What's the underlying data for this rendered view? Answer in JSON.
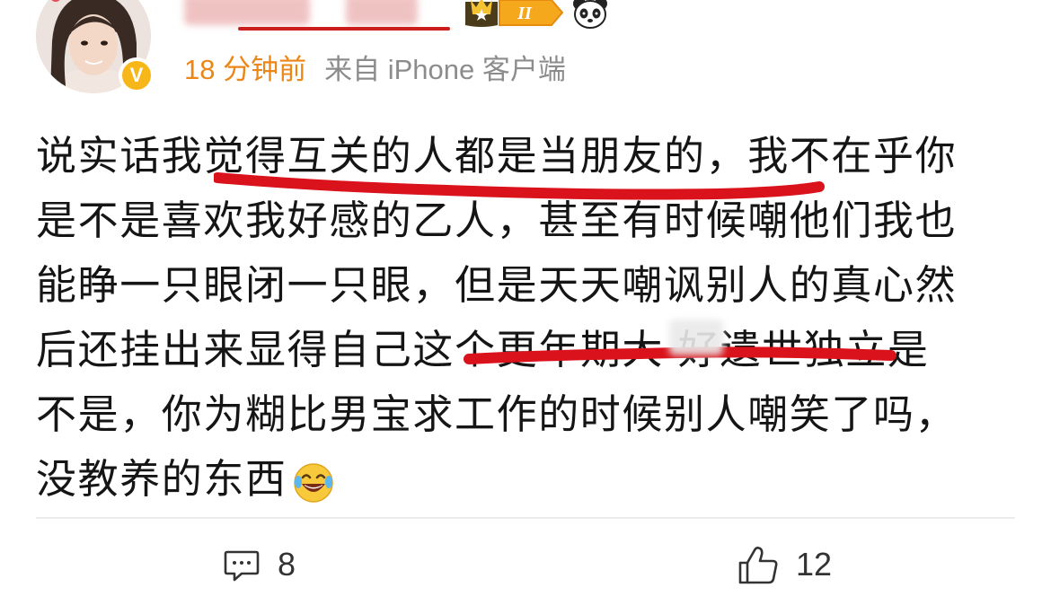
{
  "user": {
    "username_visible": "__",
    "level_badge": "II",
    "time": "18 分钟前",
    "source": "来自 iPhone 客户端"
  },
  "post": {
    "lines": [
      "说实话我觉得互关的人都是当朋友的，我不在乎你",
      "是不是喜欢我好感的乙人，甚至有时候嘲他们我也",
      "能睁一只眼闭一只眼，但是天天嘲讽别人的真心然",
      "后还挂出来显得自己这个更年期大  好遗世独立是",
      "不是，你为糊比男宝求工作的时候别人嘲笑了吗，",
      "没教养的东西"
    ],
    "emoji": "laugh-cry-emoji"
  },
  "actions": {
    "comments": "8",
    "likes": "12"
  },
  "colors": {
    "time": "#eb8617",
    "source": "#8c8c8c",
    "annotation_red": "#d9121b",
    "verified": "#f7b719"
  }
}
